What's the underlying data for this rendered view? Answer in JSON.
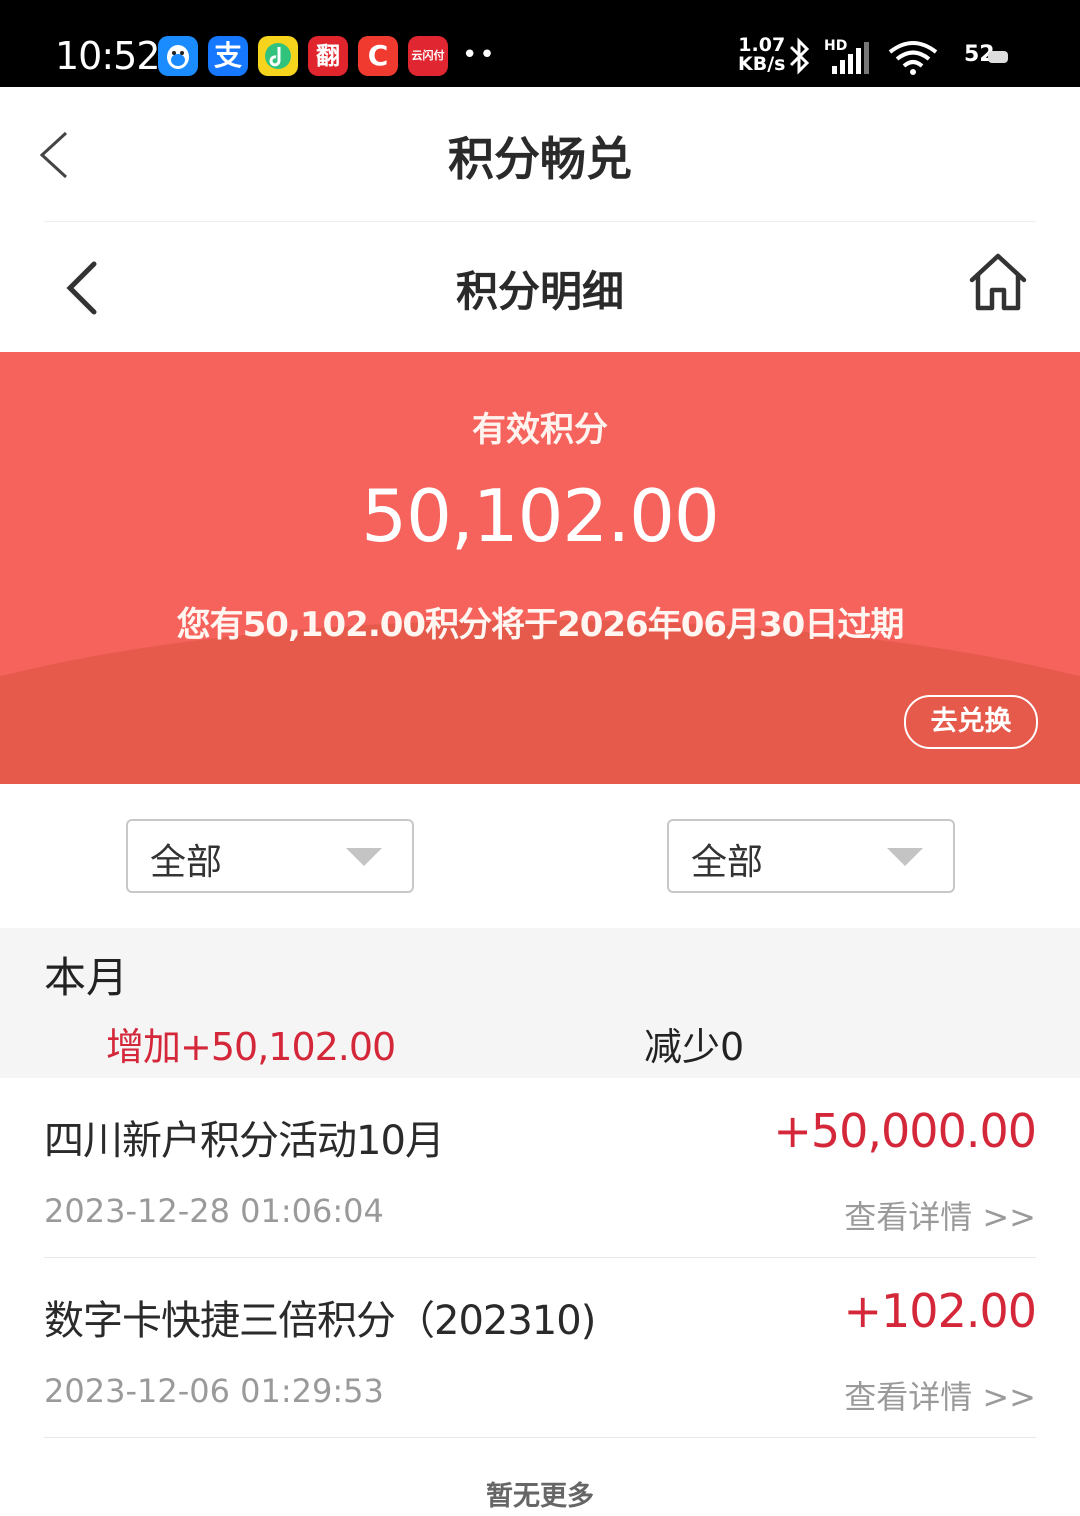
{
  "status_bar": {
    "time": "10:52",
    "speed_value": "1.07",
    "speed_unit": "KB/s",
    "network": "HD",
    "battery": "52",
    "app_icons": [
      {
        "name": "qq-app-icon",
        "color": "#1a8cff"
      },
      {
        "name": "alipay-app-icon",
        "color": "#1677ff",
        "label": "支"
      },
      {
        "name": "qqmusic-app-icon",
        "color": "#f6d31d"
      },
      {
        "name": "app-icon",
        "color": "#e0262c",
        "label": "翻"
      },
      {
        "name": "c-app-icon",
        "color": "#f03a2f",
        "label": "C"
      },
      {
        "name": "cloudpay-app-icon",
        "color": "#e02631",
        "label": "云闪付"
      }
    ]
  },
  "outer_header": {
    "title": "积分畅兑"
  },
  "inner_header": {
    "title": "积分明细"
  },
  "banner": {
    "label": "有效积分",
    "amount": "50,102.00",
    "expire_text": "您有50,102.00积分将于2026年06月30日过期",
    "redeem_label": "去兑换",
    "color": "#f6625c"
  },
  "filters": [
    {
      "label": "全部"
    },
    {
      "label": "全部"
    }
  ],
  "month": {
    "title": "本月",
    "increase": "增加+50,102.00",
    "decrease": "减少0"
  },
  "records": [
    {
      "title": "四川新户积分活动10月",
      "amount": "+50,000.00",
      "date": "2023-12-28 01:06:04",
      "link": "查看详情 >>"
    },
    {
      "title": "数字卡快捷三倍积分（202310)",
      "amount": "+102.00",
      "date": "2023-12-06 01:29:53",
      "link": "查看详情 >>"
    }
  ],
  "footer": {
    "no_more": "暂无更多"
  },
  "colors": {
    "accent_red": "#d4283a",
    "muted_text": "#9a9a9a"
  }
}
